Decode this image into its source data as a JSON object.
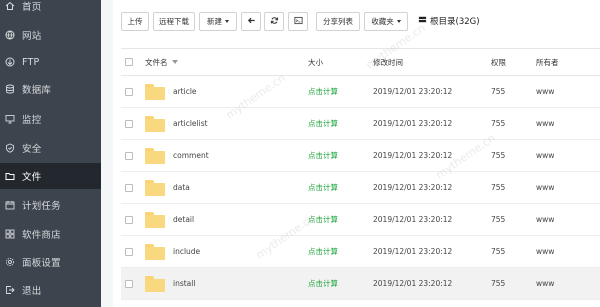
{
  "sidebar": {
    "items": [
      {
        "label": "首页",
        "icon": "home-icon"
      },
      {
        "label": "网站",
        "icon": "globe-icon"
      },
      {
        "label": "FTP",
        "icon": "ftp-icon"
      },
      {
        "label": "数据库",
        "icon": "database-icon"
      },
      {
        "label": "监控",
        "icon": "monitor-icon"
      },
      {
        "label": "安全",
        "icon": "shield-icon"
      },
      {
        "label": "文件",
        "icon": "folder-icon",
        "active": true
      },
      {
        "label": "计划任务",
        "icon": "calendar-icon"
      },
      {
        "label": "软件商店",
        "icon": "store-icon"
      },
      {
        "label": "面板设置",
        "icon": "gear-icon"
      },
      {
        "label": "退出",
        "icon": "logout-icon"
      }
    ]
  },
  "toolbar": {
    "upload": "上传",
    "remote_download": "远程下载",
    "new": "新建",
    "share_list": "分享列表",
    "favorites": "收藏夹",
    "root_dir": "根目录(32G)"
  },
  "table": {
    "headers": {
      "name": "文件名",
      "size": "大小",
      "modified": "修改时间",
      "permission": "权限",
      "owner": "所有者"
    },
    "rows": [
      {
        "name": "article",
        "size": "点击计算",
        "modified": "2019/12/01 23:20:12",
        "permission": "755",
        "owner": "www"
      },
      {
        "name": "articlelist",
        "size": "点击计算",
        "modified": "2019/12/01 23:20:12",
        "permission": "755",
        "owner": "www"
      },
      {
        "name": "comment",
        "size": "点击计算",
        "modified": "2019/12/01 23:20:12",
        "permission": "755",
        "owner": "www"
      },
      {
        "name": "data",
        "size": "点击计算",
        "modified": "2019/12/01 23:20:12",
        "permission": "755",
        "owner": "www"
      },
      {
        "name": "detail",
        "size": "点击计算",
        "modified": "2019/12/01 23:20:12",
        "permission": "755",
        "owner": "www"
      },
      {
        "name": "include",
        "size": "点击计算",
        "modified": "2019/12/01 23:20:12",
        "permission": "755",
        "owner": "www"
      },
      {
        "name": "install",
        "size": "点击计算",
        "modified": "2019/12/01 23:20:12",
        "permission": "755",
        "owner": "www"
      }
    ]
  },
  "watermark": "mytheme.cn",
  "colors": {
    "sidebar_bg": "#3c444d",
    "sidebar_active": "#22282e",
    "accent_green": "#20a53a",
    "folder_yellow": "#f9d97f"
  }
}
